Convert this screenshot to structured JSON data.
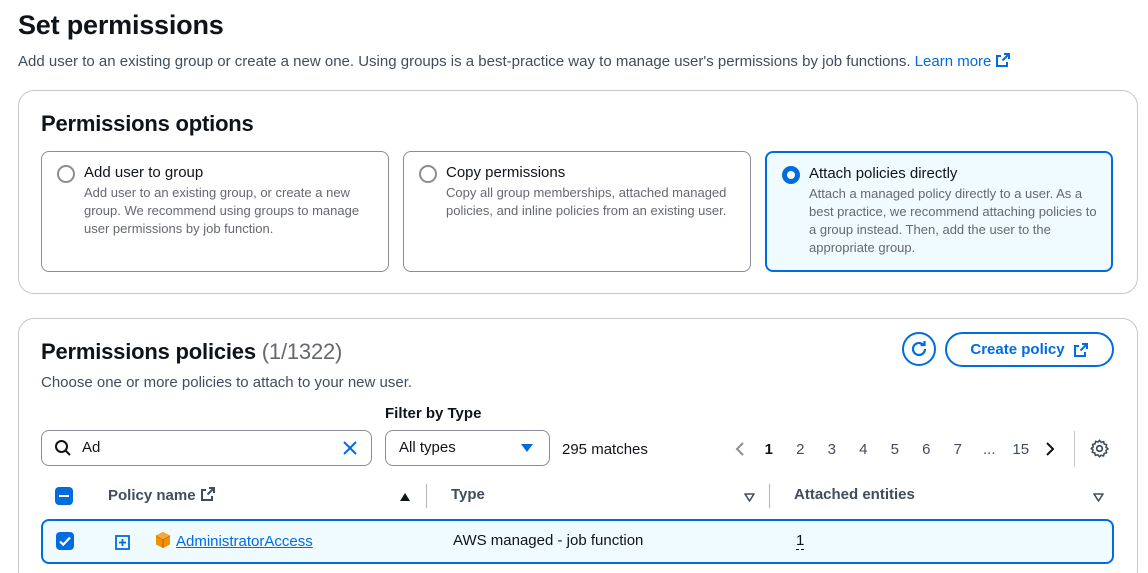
{
  "header": {
    "title": "Set permissions",
    "description": "Add user to an existing group or create a new one. Using groups is a best-practice way to manage user's permissions by job functions.",
    "learn_more": "Learn more"
  },
  "permissions_options": {
    "title": "Permissions options",
    "options": [
      {
        "label": "Add user to group",
        "description": "Add user to an existing group, or create a new group. We recommend using groups to manage user permissions by job function.",
        "selected": false
      },
      {
        "label": "Copy permissions",
        "description": "Copy all group memberships, attached managed policies, and inline policies from an existing user.",
        "selected": false
      },
      {
        "label": "Attach policies directly",
        "description": "Attach a managed policy directly to a user. As a best practice, we recommend attaching policies to a group instead. Then, add the user to the appropriate group.",
        "selected": true
      }
    ]
  },
  "permissions_policies": {
    "title": "Permissions policies",
    "count": "(1/1322)",
    "subtitle": "Choose one or more policies to attach to your new user.",
    "create_policy_label": "Create policy",
    "filter_by_type_label": "Filter by Type",
    "search_value": "Ad",
    "filter_type_value": "All types",
    "matches": "295 matches",
    "pagination": {
      "current": "1",
      "pages": [
        "1",
        "2",
        "3",
        "4",
        "5",
        "6",
        "7",
        "...",
        "15"
      ]
    },
    "columns": {
      "policy_name": "Policy name",
      "type": "Type",
      "attached_entities": "Attached entities"
    },
    "rows": [
      {
        "name": "AdministratorAccess",
        "type": "AWS managed - job function",
        "attached_entities": "1",
        "selected": true
      }
    ]
  },
  "colors": {
    "accent": "#006ce0",
    "selected_bg": "#f0fbff",
    "text": "#0f141a",
    "muted": "#656871"
  }
}
